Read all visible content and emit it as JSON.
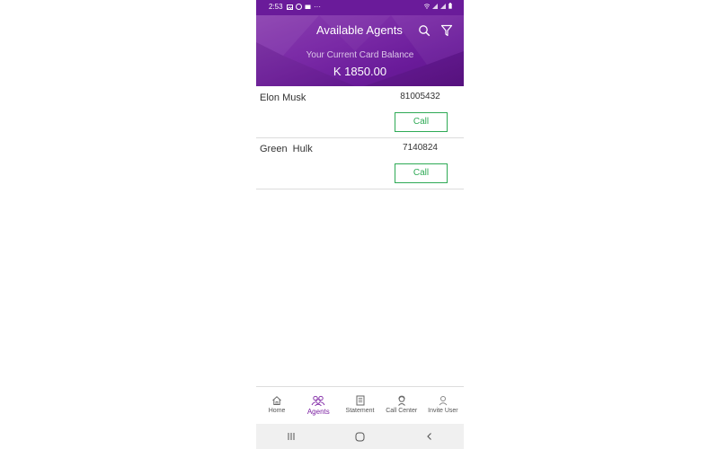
{
  "status_bar": {
    "time": "2:53",
    "left_icons": [
      "gallery-icon",
      "whatsapp-icon",
      "message-icon"
    ],
    "more": "···",
    "right_icons": [
      "wifi-icon",
      "signal-icon",
      "signal-icon",
      "battery-icon"
    ]
  },
  "header": {
    "title": "Available Agents",
    "balance_label": "Your Current Card Balance",
    "balance_value": "K 1850.00"
  },
  "agents": [
    {
      "name": "Elon Musk",
      "phone": "81005432",
      "action": "Call"
    },
    {
      "name": "Green  Hulk",
      "phone": "7140824",
      "action": "Call"
    }
  ],
  "bottom_nav": {
    "items": [
      {
        "label": "Home",
        "icon": "home-icon"
      },
      {
        "label": "Agents",
        "icon": "agents-icon",
        "active": true
      },
      {
        "label": "Statement",
        "icon": "statement-icon"
      },
      {
        "label": "Call Center",
        "icon": "call-center-icon"
      },
      {
        "label": "Invite User",
        "icon": "invite-user-icon"
      }
    ]
  },
  "colors": {
    "primary": "#6a1b9a",
    "active_nav": "#7b1fa2",
    "call_button": "#2eaa55"
  }
}
